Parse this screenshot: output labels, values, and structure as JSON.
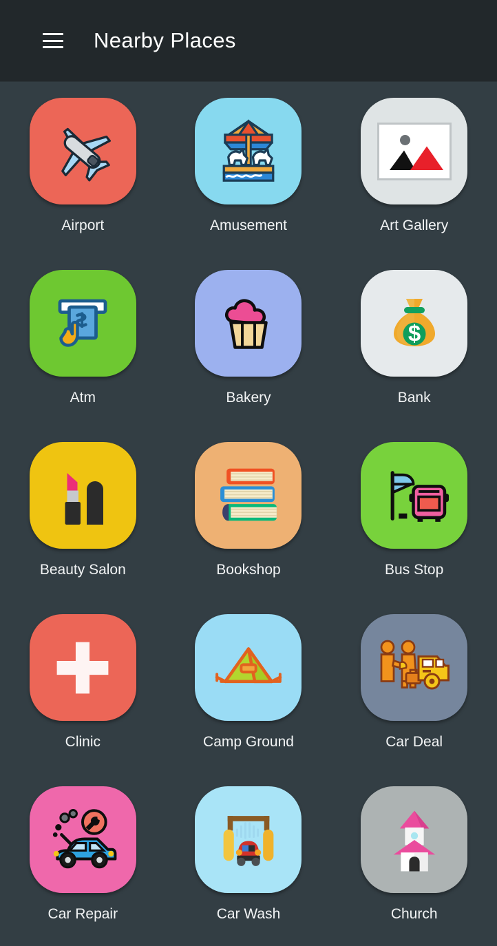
{
  "app": {
    "title": "Nearby Places",
    "menu_icon": "hamburger-menu-icon",
    "header_bg": "#22282b",
    "page_bg": "#333e44",
    "label_color": "#f2f4f5"
  },
  "grid": {
    "columns": 3,
    "items": [
      {
        "label": "Airport",
        "icon": "airplane-icon",
        "tile_color": "#ec6657"
      },
      {
        "label": "Amusement",
        "icon": "carousel-icon",
        "tile_color": "#87d9ef"
      },
      {
        "label": "Art Gallery",
        "icon": "picture-frame-icon",
        "tile_color": "#dfe4e5"
      },
      {
        "label": "Atm",
        "icon": "atm-machine-icon",
        "tile_color": "#6ec831"
      },
      {
        "label": "Bakery",
        "icon": "cupcake-icon",
        "tile_color": "#9cb1ef"
      },
      {
        "label": "Bank",
        "icon": "money-bag-icon",
        "tile_color": "#e6eaec"
      },
      {
        "label": "Beauty Salon",
        "icon": "lipstick-icon",
        "tile_color": "#efc411"
      },
      {
        "label": "Bookshop",
        "icon": "books-stack-icon",
        "tile_color": "#eeb173"
      },
      {
        "label": "Bus Stop",
        "icon": "bus-stop-icon",
        "tile_color": "#78d23c"
      },
      {
        "label": "Clinic",
        "icon": "medical-cross-icon",
        "tile_color": "#ec6657"
      },
      {
        "label": "Camp Ground",
        "icon": "tent-icon",
        "tile_color": "#9adcf5"
      },
      {
        "label": "Car Deal",
        "icon": "car-dealer-icon",
        "tile_color": "#76869d"
      },
      {
        "label": "Car Repair",
        "icon": "car-repair-icon",
        "tile_color": "#ef68ab"
      },
      {
        "label": "Car Wash",
        "icon": "car-wash-icon",
        "tile_color": "#a9e4f7"
      },
      {
        "label": "Church",
        "icon": "church-icon",
        "tile_color": "#adb3b3"
      }
    ]
  }
}
